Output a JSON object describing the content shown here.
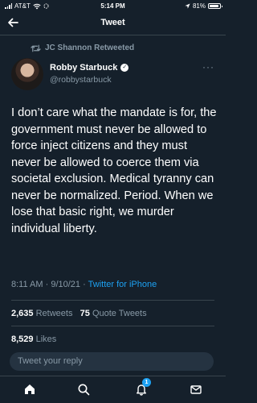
{
  "status_bar": {
    "carrier": "AT&T",
    "time": "5:14 PM",
    "battery": "81%"
  },
  "header": {
    "title": "Tweet"
  },
  "retweet": {
    "text": "JC Shannon Retweeted"
  },
  "tweet": {
    "author_name": "Robby Starbuck",
    "author_handle": "@robbystarbuck",
    "text": "I don’t care what the mandate is for, the government must never be allowed to force inject citizens and they must never be allowed to coerce them via societal exclusion. Medical tyranny can never be normalized. Period. When we lose that basic right, we murder individual liberty.",
    "time": "8:11 AM",
    "date": "9/10/21",
    "source": "Twitter for iPhone"
  },
  "stats": {
    "retweets_count": "2,635",
    "retweets_label": "Retweets",
    "quote_count": "75",
    "quote_label": "Quote Tweets",
    "likes_count": "8,529",
    "likes_label": "Likes"
  },
  "reply": {
    "placeholder": "Tweet your reply"
  },
  "tab_bar": {
    "notifications_badge": "1"
  }
}
